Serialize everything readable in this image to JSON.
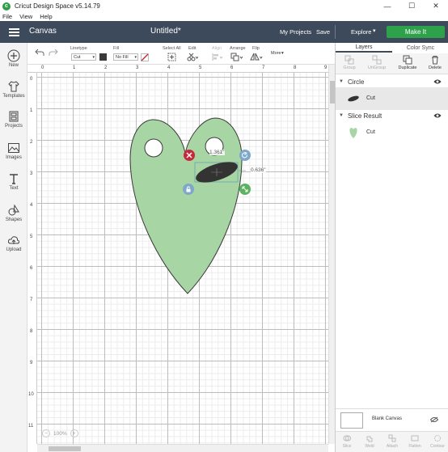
{
  "window": {
    "title": "Cricut Design Space  v5.14.79",
    "minimize": "—",
    "maximize": "☐",
    "close": "✕"
  },
  "menu": {
    "items": [
      "File",
      "View",
      "Help"
    ]
  },
  "header": {
    "section": "Canvas",
    "doc_title": "Untitled*",
    "my_projects": "My Projects",
    "save": "Save",
    "explore": "Explore",
    "make_it": "Make It"
  },
  "sidebar": {
    "items": [
      {
        "label": "New",
        "icon": "plus-icon"
      },
      {
        "label": "Templates",
        "icon": "shirt-icon"
      },
      {
        "label": "Projects",
        "icon": "projects-icon"
      },
      {
        "label": "Images",
        "icon": "image-icon"
      },
      {
        "label": "Text",
        "icon": "text-icon"
      },
      {
        "label": "Shapes",
        "icon": "shapes-icon"
      },
      {
        "label": "Upload",
        "icon": "cloud-upload-icon"
      }
    ]
  },
  "toolbar": {
    "linetype_label": "Linetype",
    "linetype_value": "Cut",
    "fill_label": "Fill",
    "fill_value": "No Fill",
    "select_all": "Select All",
    "edit": "Edit",
    "align": "Align",
    "arrange": "Arrange",
    "flip": "Flip",
    "more": "More",
    "swatch_color": "#3a3a3a"
  },
  "ruler": {
    "horizontal": [
      "0",
      "1",
      "2",
      "3",
      "4",
      "5",
      "6",
      "7",
      "8",
      "9"
    ],
    "vertical": [
      "0",
      "1",
      "2",
      "3",
      "4",
      "5",
      "6",
      "7",
      "8",
      "9",
      "10",
      "11"
    ]
  },
  "canvas": {
    "width_label": "1.361\"",
    "height_label": "0.636\"",
    "heart_color": "#a8d5a4",
    "shape_color": "#333333"
  },
  "zoom": {
    "level": "100%",
    "minus": "−",
    "plus": "+"
  },
  "layers_panel": {
    "tabs": [
      "Layers",
      "Color Sync"
    ],
    "actions": [
      "Group",
      "UnGroup",
      "Duplicate",
      "Delete"
    ],
    "groups": [
      {
        "name": "Circle",
        "row_label": "Cut"
      },
      {
        "name": "Slice Result",
        "row_label": "Cut"
      }
    ],
    "blank_canvas": "Blank Canvas",
    "bottom_actions": [
      "Slice",
      "Weld",
      "Attach",
      "Flatten",
      "Contour"
    ]
  }
}
